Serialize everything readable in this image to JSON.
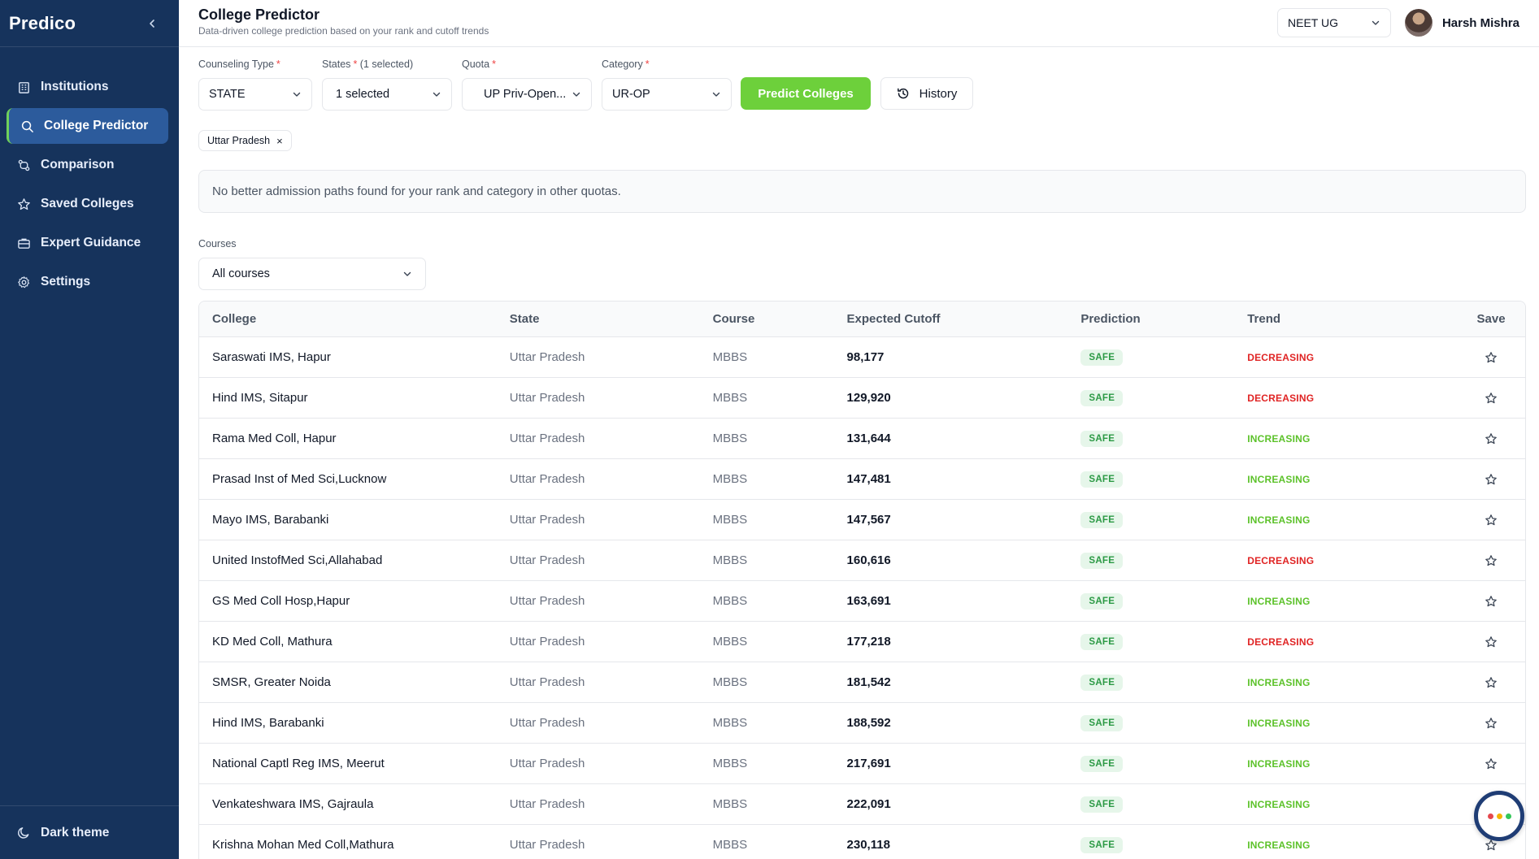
{
  "sidebar": {
    "brand": "Predico",
    "items": [
      {
        "label": "Institutions",
        "icon": "building-icon"
      },
      {
        "label": "College Predictor",
        "icon": "search-icon",
        "active": true
      },
      {
        "label": "Comparison",
        "icon": "compare-icon"
      },
      {
        "label": "Saved Colleges",
        "icon": "star-icon"
      },
      {
        "label": "Expert Guidance",
        "icon": "briefcase-icon"
      },
      {
        "label": "Settings",
        "icon": "gear-icon"
      }
    ],
    "theme_toggle": "Dark theme"
  },
  "header": {
    "title": "College Predictor",
    "subtitle": "Data-driven college prediction based on your rank and cutoff trends",
    "exam": "NEET UG",
    "user_name": "Harsh Mishra"
  },
  "filters": {
    "counseling_type": {
      "label": "Counseling Type",
      "value": "STATE"
    },
    "states": {
      "label": "States",
      "label_suffix": "(1 selected)",
      "value": "1 selected"
    },
    "quota": {
      "label": "Quota",
      "value": "UP Priv-Open..."
    },
    "category": {
      "label": "Category",
      "value": "UR-OP"
    },
    "predict_button": "Predict Colleges",
    "history_button": "History",
    "required_mark": "*"
  },
  "selected_chips": [
    {
      "label": "Uttar Pradesh",
      "remove": "×"
    }
  ],
  "notice": "No better admission paths found for your rank and category in other quotas.",
  "courses": {
    "label": "Courses",
    "value": "All courses"
  },
  "table": {
    "headers": {
      "college": "College",
      "state": "State",
      "course": "Course",
      "cutoff": "Expected Cutoff",
      "prediction": "Prediction",
      "trend": "Trend",
      "save": "Save"
    },
    "rows": [
      {
        "college": "Saraswati IMS, Hapur",
        "state": "Uttar Pradesh",
        "course": "MBBS",
        "cutoff": "98,177",
        "prediction": "SAFE",
        "trend": "DECREASING"
      },
      {
        "college": "Hind IMS, Sitapur",
        "state": "Uttar Pradesh",
        "course": "MBBS",
        "cutoff": "129,920",
        "prediction": "SAFE",
        "trend": "DECREASING"
      },
      {
        "college": "Rama Med Coll, Hapur",
        "state": "Uttar Pradesh",
        "course": "MBBS",
        "cutoff": "131,644",
        "prediction": "SAFE",
        "trend": "INCREASING"
      },
      {
        "college": "Prasad Inst of Med Sci,Lucknow",
        "state": "Uttar Pradesh",
        "course": "MBBS",
        "cutoff": "147,481",
        "prediction": "SAFE",
        "trend": "INCREASING"
      },
      {
        "college": "Mayo IMS, Barabanki",
        "state": "Uttar Pradesh",
        "course": "MBBS",
        "cutoff": "147,567",
        "prediction": "SAFE",
        "trend": "INCREASING"
      },
      {
        "college": "United InstofMed Sci,Allahabad",
        "state": "Uttar Pradesh",
        "course": "MBBS",
        "cutoff": "160,616",
        "prediction": "SAFE",
        "trend": "DECREASING"
      },
      {
        "college": "GS Med Coll Hosp,Hapur",
        "state": "Uttar Pradesh",
        "course": "MBBS",
        "cutoff": "163,691",
        "prediction": "SAFE",
        "trend": "INCREASING"
      },
      {
        "college": "KD Med Coll, Mathura",
        "state": "Uttar Pradesh",
        "course": "MBBS",
        "cutoff": "177,218",
        "prediction": "SAFE",
        "trend": "DECREASING"
      },
      {
        "college": "SMSR, Greater Noida",
        "state": "Uttar Pradesh",
        "course": "MBBS",
        "cutoff": "181,542",
        "prediction": "SAFE",
        "trend": "INCREASING"
      },
      {
        "college": "Hind IMS, Barabanki",
        "state": "Uttar Pradesh",
        "course": "MBBS",
        "cutoff": "188,592",
        "prediction": "SAFE",
        "trend": "INCREASING"
      },
      {
        "college": "National Captl Reg IMS, Meerut",
        "state": "Uttar Pradesh",
        "course": "MBBS",
        "cutoff": "217,691",
        "prediction": "SAFE",
        "trend": "INCREASING"
      },
      {
        "college": "Venkateshwara IMS, Gajraula",
        "state": "Uttar Pradesh",
        "course": "MBBS",
        "cutoff": "222,091",
        "prediction": "SAFE",
        "trend": "INCREASING"
      },
      {
        "college": "Krishna Mohan Med Coll,Mathura",
        "state": "Uttar Pradesh",
        "course": "MBBS",
        "cutoff": "230,118",
        "prediction": "SAFE",
        "trend": "INCREASING"
      }
    ]
  },
  "colors": {
    "sidebar_bg": "#16335c",
    "active_item_bg": "#2c5b9c",
    "accent_green": "#6dd03b",
    "trend_decreasing": "#e02424",
    "trend_increasing": "#5cc22a",
    "safe_badge_bg": "#e6f6ea",
    "safe_badge_text": "#2c9a45"
  }
}
